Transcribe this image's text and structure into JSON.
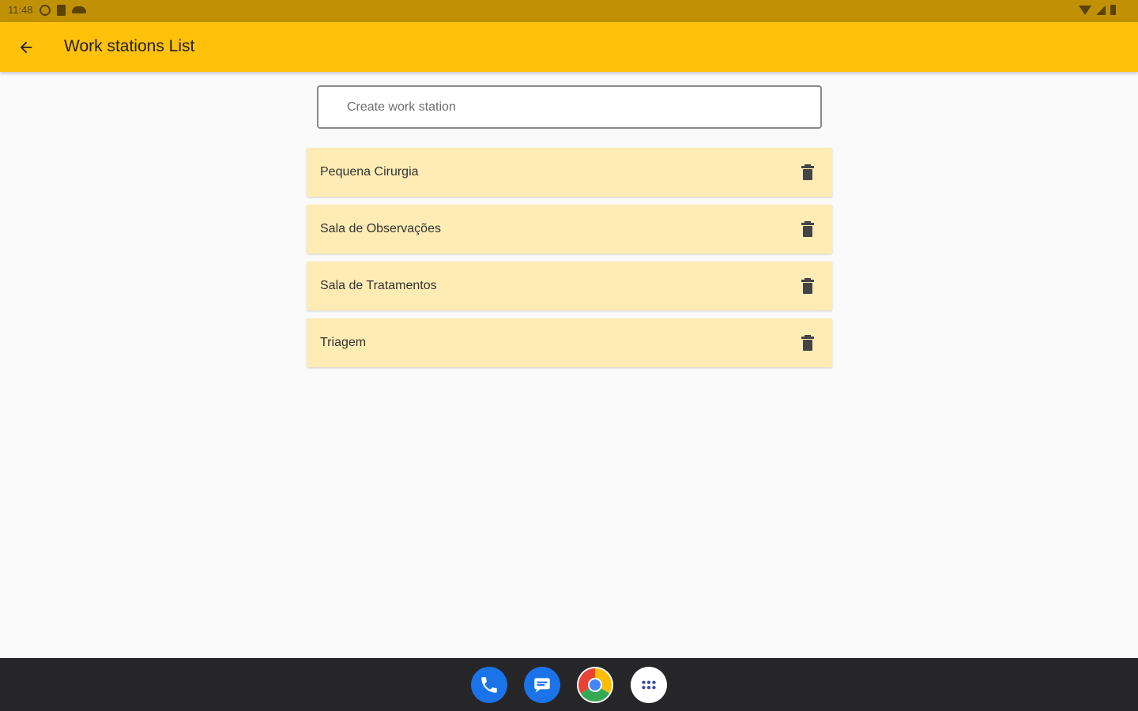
{
  "status_bar": {
    "time": "11:48",
    "left_icons": [
      "do-not-disturb-icon",
      "sd-card-icon",
      "cloud-icon"
    ],
    "right_icons": [
      "wifi-icon",
      "signal-icon",
      "battery-icon"
    ]
  },
  "app_bar": {
    "title": "Work stations List",
    "back_icon": "arrow-back-icon",
    "background": "#ffc10a"
  },
  "create_input": {
    "placeholder": "Create work station",
    "value": ""
  },
  "work_stations": [
    {
      "name": "Pequena Cirurgia",
      "action_icon": "trash-icon"
    },
    {
      "name": "Sala de Observações",
      "action_icon": "trash-icon"
    },
    {
      "name": "Sala de Tratamentos",
      "action_icon": "trash-icon"
    },
    {
      "name": "Triagem",
      "action_icon": "trash-icon"
    }
  ],
  "dock": {
    "apps": [
      "phone-icon",
      "messages-icon",
      "chrome-icon",
      "app-drawer-icon"
    ]
  },
  "colors": {
    "status_bar": "#c19105",
    "list_item": "#ffecb5",
    "nav_bar": "#262629"
  }
}
